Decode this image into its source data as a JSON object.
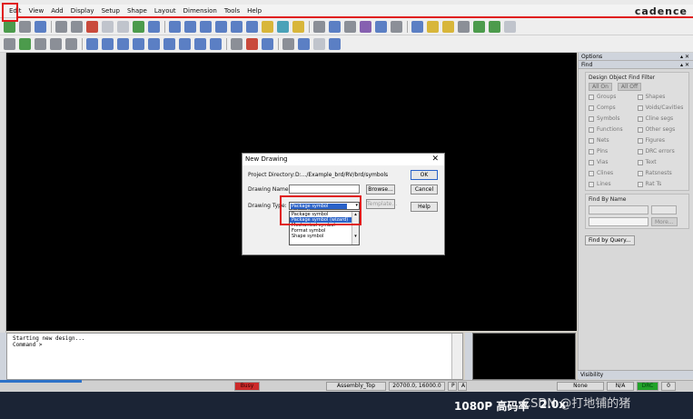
{
  "menubar": {
    "items": [
      "Edit",
      "View",
      "Add",
      "Display",
      "Setup",
      "Shape",
      "Layout",
      "Dimension",
      "Tools",
      "Help"
    ],
    "brand": "cadence"
  },
  "dialog": {
    "title": "New Drawing",
    "close_glyph": "✕",
    "project_directory_label": "Project Directory:",
    "project_directory_value": "D:.../Example_brd/RV/brd/symbols",
    "drawing_name_label": "Drawing Name:",
    "drawing_name_value": "",
    "drawing_type_label": "Drawing Type:",
    "drawing_type_selected": "Package symbol (wizard)",
    "drawing_type_options": [
      "Package symbol",
      "Package symbol (wizard)",
      "Mechanical symbol",
      "Format symbol",
      "Shape symbol"
    ],
    "ok_label": "OK",
    "cancel_label": "Cancel",
    "browse_label": "Browse...",
    "template_label": "Template...",
    "help_label": "Help"
  },
  "right_panel": {
    "options_title": "Options",
    "find_title": "Find",
    "filter_group_title": "Design Object Find Filter",
    "all_on": "All On",
    "all_off": "All Off",
    "filter_items": [
      "Groups",
      "Shapes",
      "Comps",
      "Voids/Cavities",
      "Symbols",
      "Cline segs",
      "Functions",
      "Other segs",
      "Nets",
      "Figures",
      "Pins",
      "DRC errors",
      "Vias",
      "Text",
      "Clines",
      "Ratsnests",
      "Lines",
      "Rat Ts"
    ],
    "find_by_name_title": "Find By Name",
    "more_label": "More...",
    "find_by_query_label": "Find by Query...",
    "visibility_title": "Visibility"
  },
  "command_window": {
    "lines": [
      "Starting new design...",
      "Command >"
    ]
  },
  "status_bar": {
    "busy": "Busy",
    "class": "Assembly_Top",
    "coords": "20700.0, 16000.0",
    "p": "P",
    "a": "A",
    "mode": "None",
    "na": "N/A",
    "drc": "DRC",
    "count": "0"
  },
  "video_overlay": {
    "quality": "1080P 高码率",
    "speed": "2.0x",
    "watermark": "CSDN @打地铺的猪"
  }
}
